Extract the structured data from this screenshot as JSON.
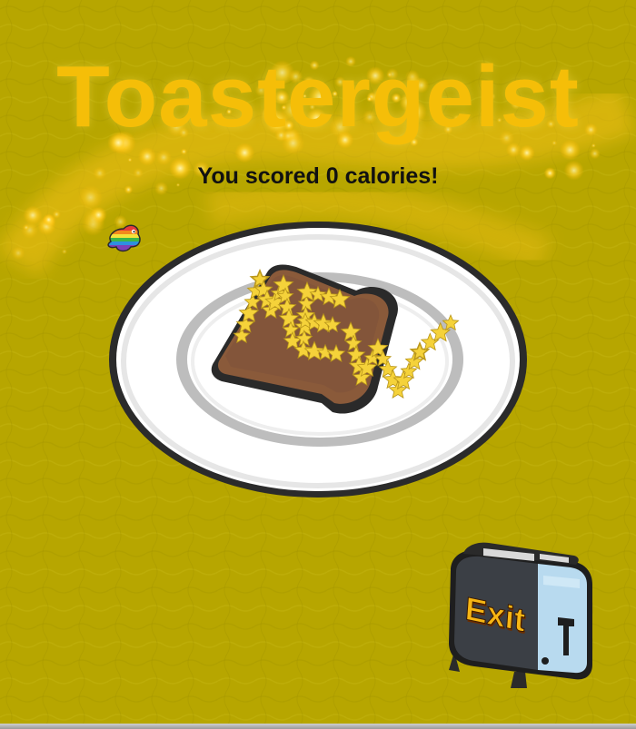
{
  "title": "Toastergeist",
  "score_text": "You scored 0 calories!",
  "exit_label": "Exit",
  "toast_letters": "MEW",
  "colors": {
    "background": "#B8A800",
    "title": "#F5BE08",
    "score": "#111111",
    "exit_label": "#F7B614",
    "toaster_body": "#3B3F45",
    "toaster_side": "#B8DAEF",
    "plate": "#FFFFFF",
    "toast": "#8A5A3A",
    "stars": "#F5D23A"
  },
  "icons": {
    "rainbow_creature": "rainbow-blob-icon",
    "exit": "toaster-icon"
  }
}
